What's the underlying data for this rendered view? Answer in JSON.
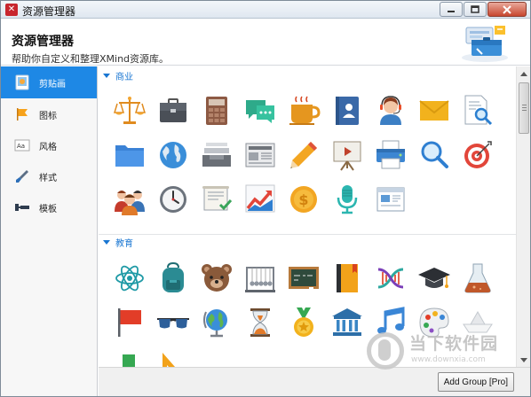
{
  "window": {
    "title": "资源管理器"
  },
  "header": {
    "title": "资源管理器",
    "description": "帮助你自定义和整理XMind资源库。"
  },
  "sidebar": {
    "items": [
      {
        "label": "剪贴画",
        "icon": "clipart-icon",
        "active": true
      },
      {
        "label": "图标",
        "icon": "flag-icon",
        "active": false
      },
      {
        "label": "风格",
        "icon": "style-icon",
        "active": false
      },
      {
        "label": "样式",
        "icon": "brush-icon",
        "active": false
      },
      {
        "label": "模板",
        "icon": "template-icon",
        "active": false
      }
    ]
  },
  "sections": [
    {
      "label": "商业",
      "items": [
        "scales-icon",
        "briefcase-icon",
        "calculator-icon",
        "chat-bubbles-icon",
        "coffee-cup-icon",
        "address-book-icon",
        "customer-service-icon",
        "envelope-icon",
        "document-search-icon",
        "folder-icon",
        "globe-icon",
        "inbox-tray-icon",
        "newspaper-icon",
        "pencil-icon",
        "presentation-board-icon",
        "printer-icon",
        "magnifier-icon",
        "target-icon",
        "team-icon",
        "clock-icon",
        "certificate-icon",
        "growth-chart-icon",
        "dollar-coin-icon",
        "microphone-icon",
        "browser-window-icon"
      ]
    },
    {
      "label": "教育",
      "items": [
        "atom-icon",
        "backpack-icon",
        "teddy-bear-icon",
        "newtons-cradle-icon",
        "chalkboard-icon",
        "notebook-icon",
        "dna-icon",
        "graduation-cap-icon",
        "flask-icon",
        "red-flag-icon",
        "glasses-icon",
        "desk-globe-icon",
        "hourglass-icon",
        "medal-icon",
        "museum-icon",
        "music-note-icon",
        "paint-palette-icon",
        "paper-boat-icon",
        "colored-blocks-icon",
        "triangle-ruler-icon"
      ]
    }
  ],
  "footer": {
    "add_group_label": "Add Group [Pro]"
  },
  "watermark": {
    "text": "当下软件园",
    "url": "www.downxia.com"
  },
  "colors": {
    "accent": "#1e88e5",
    "section_label": "#1976d2",
    "close_button": "#c7462f"
  }
}
